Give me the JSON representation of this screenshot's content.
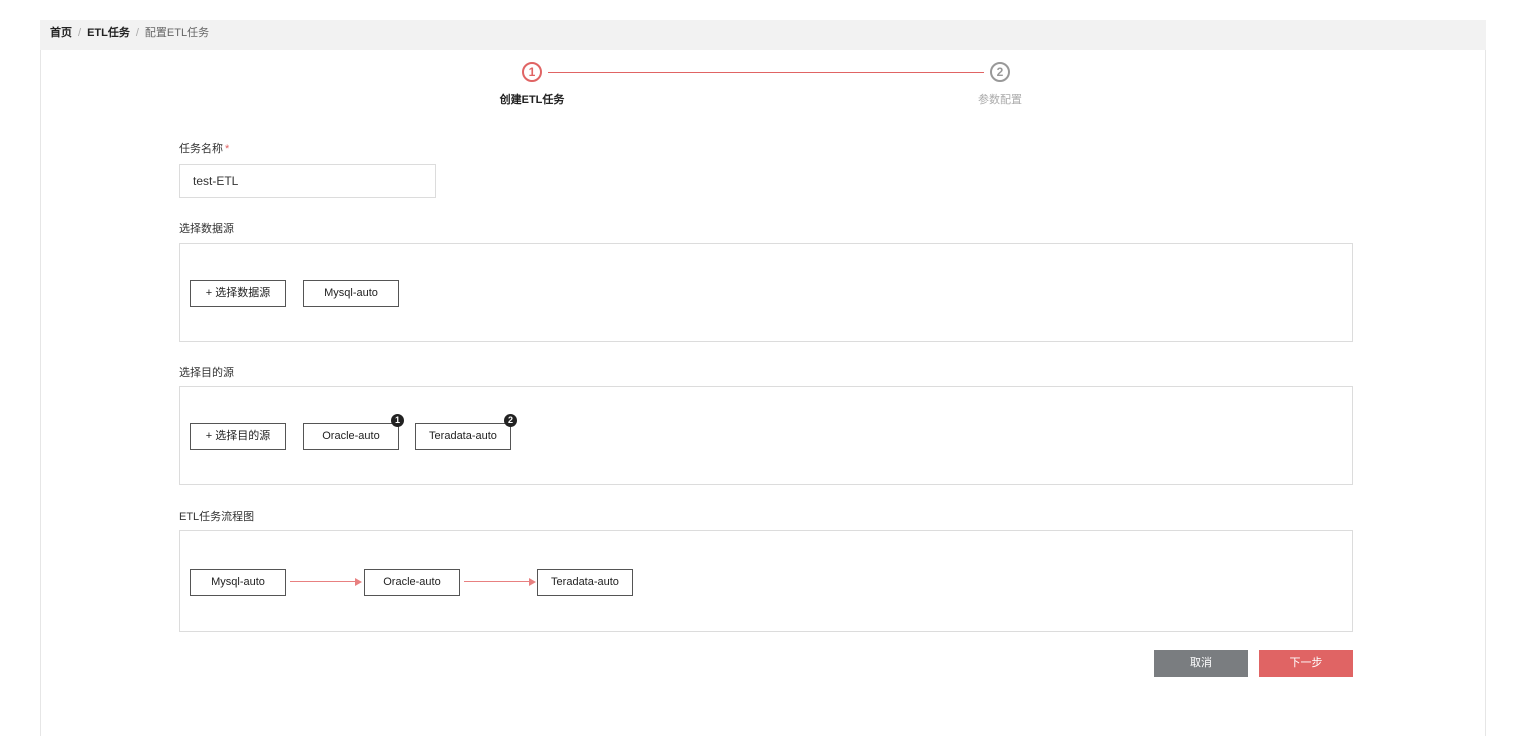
{
  "breadcrumb": {
    "home": "首页",
    "etl_tasks": "ETL任务",
    "current": "配置ETL任务",
    "separator": "/"
  },
  "steps": [
    {
      "number": "1",
      "label": "创建ETL任务",
      "state": "active"
    },
    {
      "number": "2",
      "label": "参数配置",
      "state": "inactive"
    }
  ],
  "form": {
    "task_name_label": "任务名称",
    "required_mark": "*",
    "task_name_value": "test-ETL",
    "source_label": "选择数据源",
    "source_add_button": "+ 选择数据源",
    "source_items": [
      "Mysql-auto"
    ],
    "target_label": "选择目的源",
    "target_add_button": "+ 选择目的源",
    "target_items": [
      {
        "name": "Oracle-auto",
        "badge": "1"
      },
      {
        "name": "Teradata-auto",
        "badge": "2"
      }
    ],
    "flow_label": "ETL任务流程图",
    "flow_nodes": [
      "Mysql-auto",
      "Oracle-auto",
      "Teradata-auto"
    ]
  },
  "actions": {
    "cancel": "取消",
    "next": "下一步"
  },
  "colors": {
    "accent": "#e06464",
    "cancel_bg": "#7a7d80",
    "arrow": "#e88080"
  }
}
